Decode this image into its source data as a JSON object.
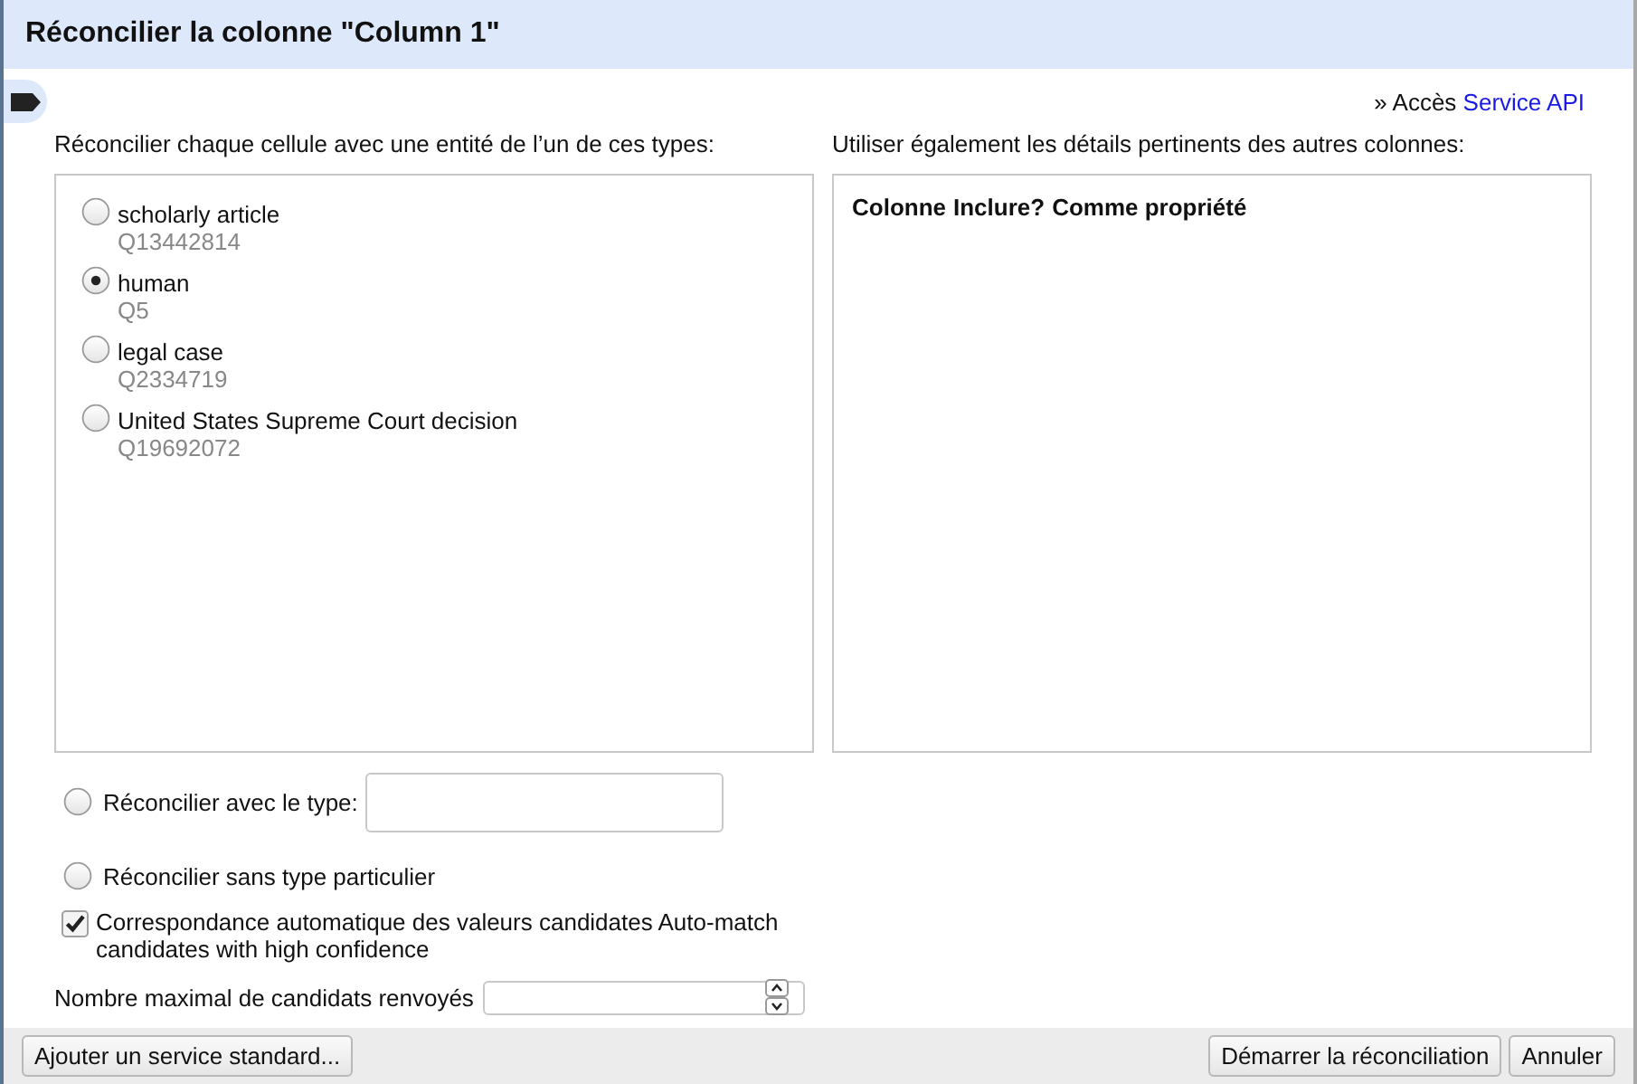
{
  "dialog": {
    "title": "Réconcilier la colonne \"Column 1\""
  },
  "service_access": {
    "prefix": "» Accès",
    "link": "Service API"
  },
  "types_label": "Réconcilier chaque cellule avec une entité de l’un de ces types:",
  "types": [
    {
      "name": "scholarly article",
      "id": "Q13442814",
      "selected": false
    },
    {
      "name": "human",
      "id": "Q5",
      "selected": true
    },
    {
      "name": "legal case",
      "id": "Q2334719",
      "selected": false
    },
    {
      "name": "United States Supreme Court decision",
      "id": "Q19692072",
      "selected": false
    }
  ],
  "columns_label": "Utiliser également les détails pertinents des autres colonnes:",
  "columns_table": {
    "columns": [
      "Colonne",
      "Inclure?",
      "Comme propriété"
    ]
  },
  "options": [
    {
      "kind": "radio-field",
      "label": "Réconcilier avec le type:",
      "selected": false
    },
    {
      "kind": "radio",
      "label": "Réconcilier sans type particulier",
      "selected": false
    },
    {
      "kind": "checkbox",
      "label": "Correspondance automatique des valeurs candidates Auto-match candidates with high confidence",
      "checked": true
    }
  ],
  "max_candidates": {
    "label": "Nombre maximal de candidats renvoyés"
  },
  "footer": {
    "left_buttons": [
      "Ajouter un service standard..."
    ],
    "right_buttons": [
      "Démarrer la réconciliation",
      "Annuler"
    ]
  }
}
